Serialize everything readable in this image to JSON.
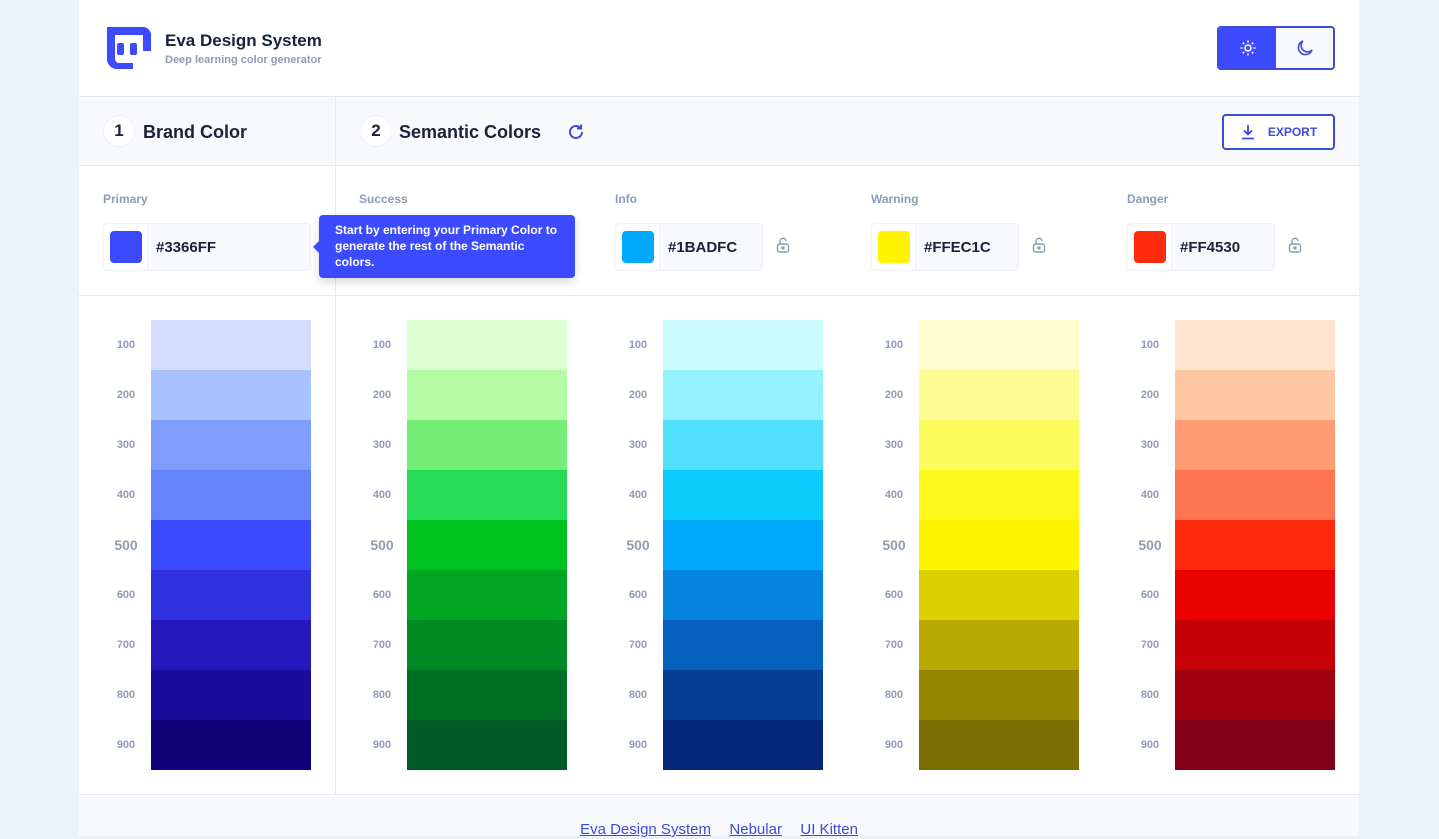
{
  "app": {
    "title": "Eva Design System",
    "subtitle": "Deep learning color generator"
  },
  "theme_toggle": {
    "active": "light",
    "icons": [
      "sun-icon",
      "moon-icon"
    ]
  },
  "sections": {
    "brand": {
      "number": "1",
      "title": "Brand Color"
    },
    "semantic": {
      "number": "2",
      "title": "Semantic Colors"
    }
  },
  "export_label": "EXPORT",
  "tooltip": "Start by entering your Primary Color to generate the rest of the Semantic colors.",
  "accent": "#3d4bd6",
  "palettes": [
    {
      "label": "Primary",
      "hex": "#3366FF",
      "swatch": "#3a4afb",
      "locked": false,
      "steps": [
        "#d2defc",
        "#a9c1fd",
        "#7f9efc",
        "#6484fb",
        "#3a4afb",
        "#2f31e0",
        "#2519be",
        "#1a0b9a",
        "#120278"
      ]
    },
    {
      "label": "Success",
      "hex": "",
      "swatch": "#00c21e",
      "locked": false,
      "steps": [
        "#dbfed3",
        "#b3fca5",
        "#74ee76",
        "#26db55",
        "#00c21e",
        "#00a622",
        "#008a24",
        "#006f25",
        "#005c24"
      ]
    },
    {
      "label": "Info",
      "hex": "#1BADFC",
      "swatch": "#00a9fc",
      "locked": false,
      "steps": [
        "#cbfcfe",
        "#96f1fe",
        "#50dffc",
        "#0accfc",
        "#00a9fc",
        "#0484de",
        "#0660be",
        "#043f94",
        "#04277a"
      ]
    },
    {
      "label": "Warning",
      "hex": "#FFEC1C",
      "swatch": "#fff400",
      "locked": false,
      "steps": [
        "#fffdcf",
        "#fcfb94",
        "#fdfa5c",
        "#fff81c",
        "#fff400",
        "#ddd000",
        "#b8aa00",
        "#938600",
        "#7a6e00"
      ]
    },
    {
      "label": "Danger",
      "hex": "#FF4530",
      "swatch": "#ff2a0b",
      "locked": false,
      "steps": [
        "#ffe5d0",
        "#ffc6a2",
        "#ff9c73",
        "#ff7551",
        "#ff2a0b",
        "#eb0000",
        "#c50006",
        "#a0000e",
        "#820017"
      ]
    }
  ],
  "step_labels": [
    "100",
    "200",
    "300",
    "400",
    "500",
    "600",
    "700",
    "800",
    "900"
  ],
  "footer": {
    "links": [
      "Eva Design System",
      "Nebular",
      "UI Kitten"
    ]
  }
}
